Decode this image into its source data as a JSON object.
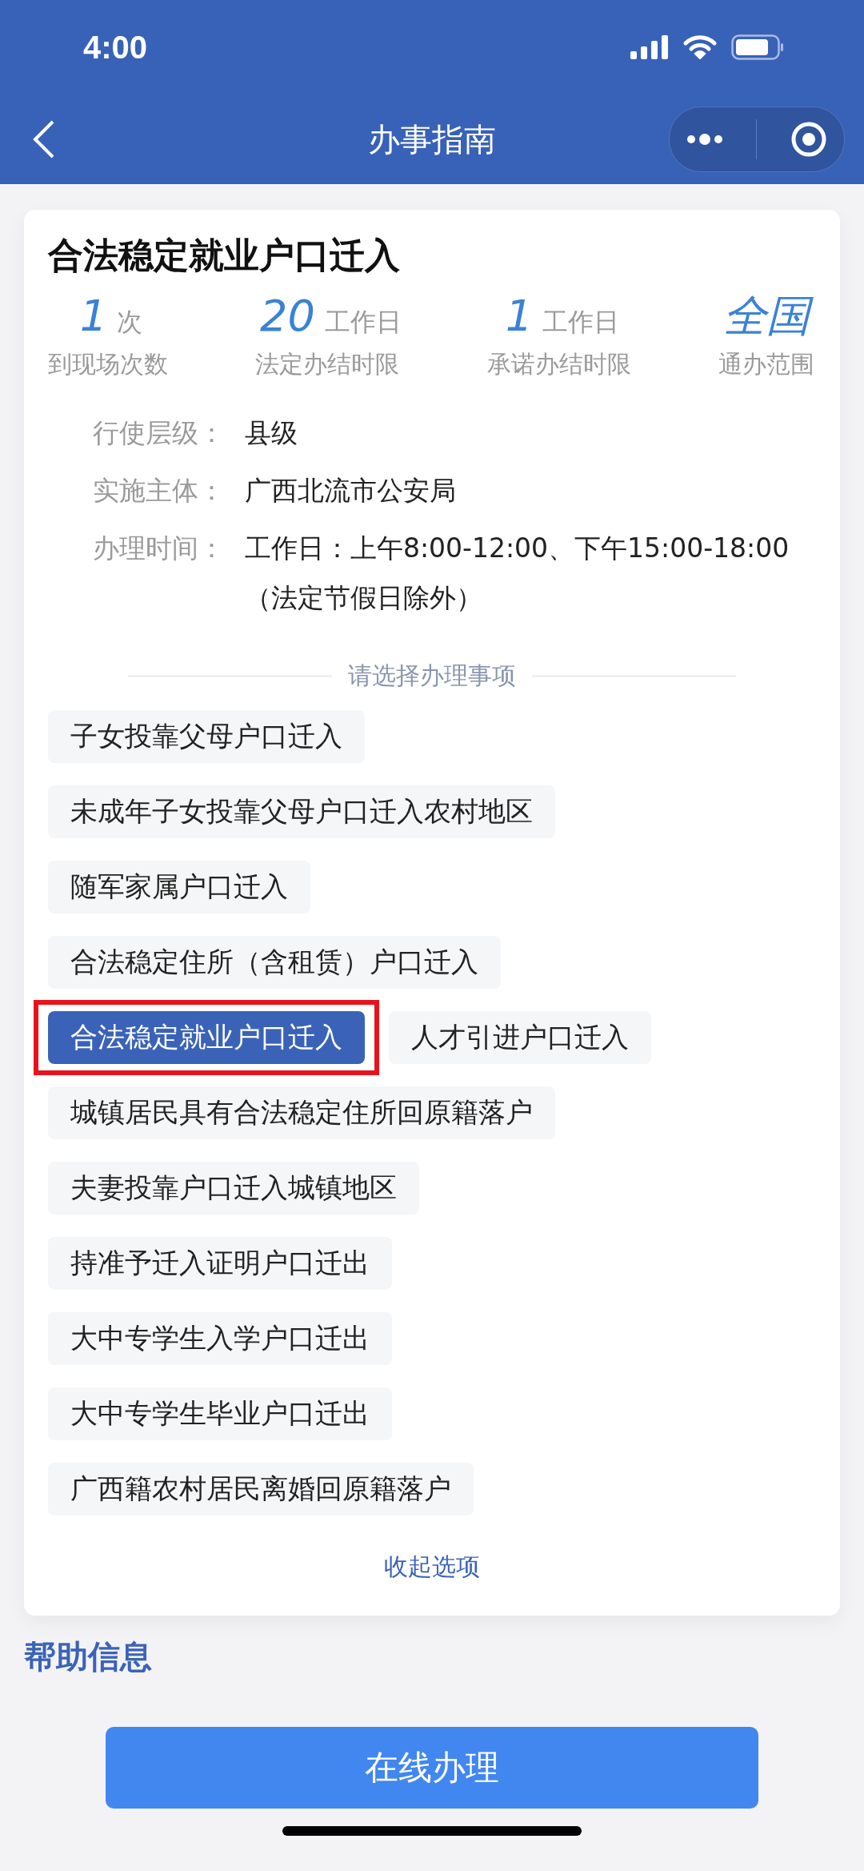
{
  "status_bar": {
    "time": "4:00"
  },
  "nav": {
    "title": "办事指南"
  },
  "card": {
    "title": "合法稳定就业户口迁入",
    "stats": [
      {
        "value": "1",
        "unit": "次",
        "label": "到现场次数"
      },
      {
        "value": "20",
        "unit": "工作日",
        "label": "法定办结时限"
      },
      {
        "value": "1",
        "unit": "工作日",
        "label": "承诺办结时限"
      },
      {
        "value": "全国",
        "label": "通办范围"
      }
    ],
    "info": [
      {
        "label": "行使层级：",
        "value": "县级"
      },
      {
        "label": "实施主体：",
        "value": "广西北流市公安局"
      },
      {
        "label": "办理时间：",
        "value": "工作日：上午8:00-12:00、下午15:00-18:00（法定节假日除外）"
      }
    ],
    "divider_text": "请选择办理事项",
    "option_rows": [
      [
        {
          "label": "子女投靠父母户口迁入",
          "selected": false
        }
      ],
      [
        {
          "label": "未成年子女投靠父母户口迁入农村地区",
          "selected": false
        }
      ],
      [
        {
          "label": "随军家属户口迁入",
          "selected": false
        }
      ],
      [
        {
          "label": "合法稳定住所（含租赁）户口迁入",
          "selected": false
        }
      ],
      [
        {
          "label": "合法稳定就业户口迁入",
          "selected": true,
          "marked": true
        },
        {
          "label": "人才引进户口迁入",
          "selected": false
        }
      ],
      [
        {
          "label": "城镇居民具有合法稳定住所回原籍落户",
          "selected": false
        }
      ],
      [
        {
          "label": "夫妻投靠户口迁入城镇地区",
          "selected": false
        }
      ],
      [
        {
          "label": "持准予迁入证明户口迁出",
          "selected": false
        }
      ],
      [
        {
          "label": "大中专学生入学户口迁出",
          "selected": false
        }
      ],
      [
        {
          "label": "大中专学生毕业户口迁出",
          "selected": false
        }
      ],
      [
        {
          "label": "广西籍农村居民离婚回原籍落户",
          "selected": false
        }
      ]
    ],
    "collapse_link": "收起选项"
  },
  "section_heading": "帮助信息",
  "primary_button": "在线办理"
}
